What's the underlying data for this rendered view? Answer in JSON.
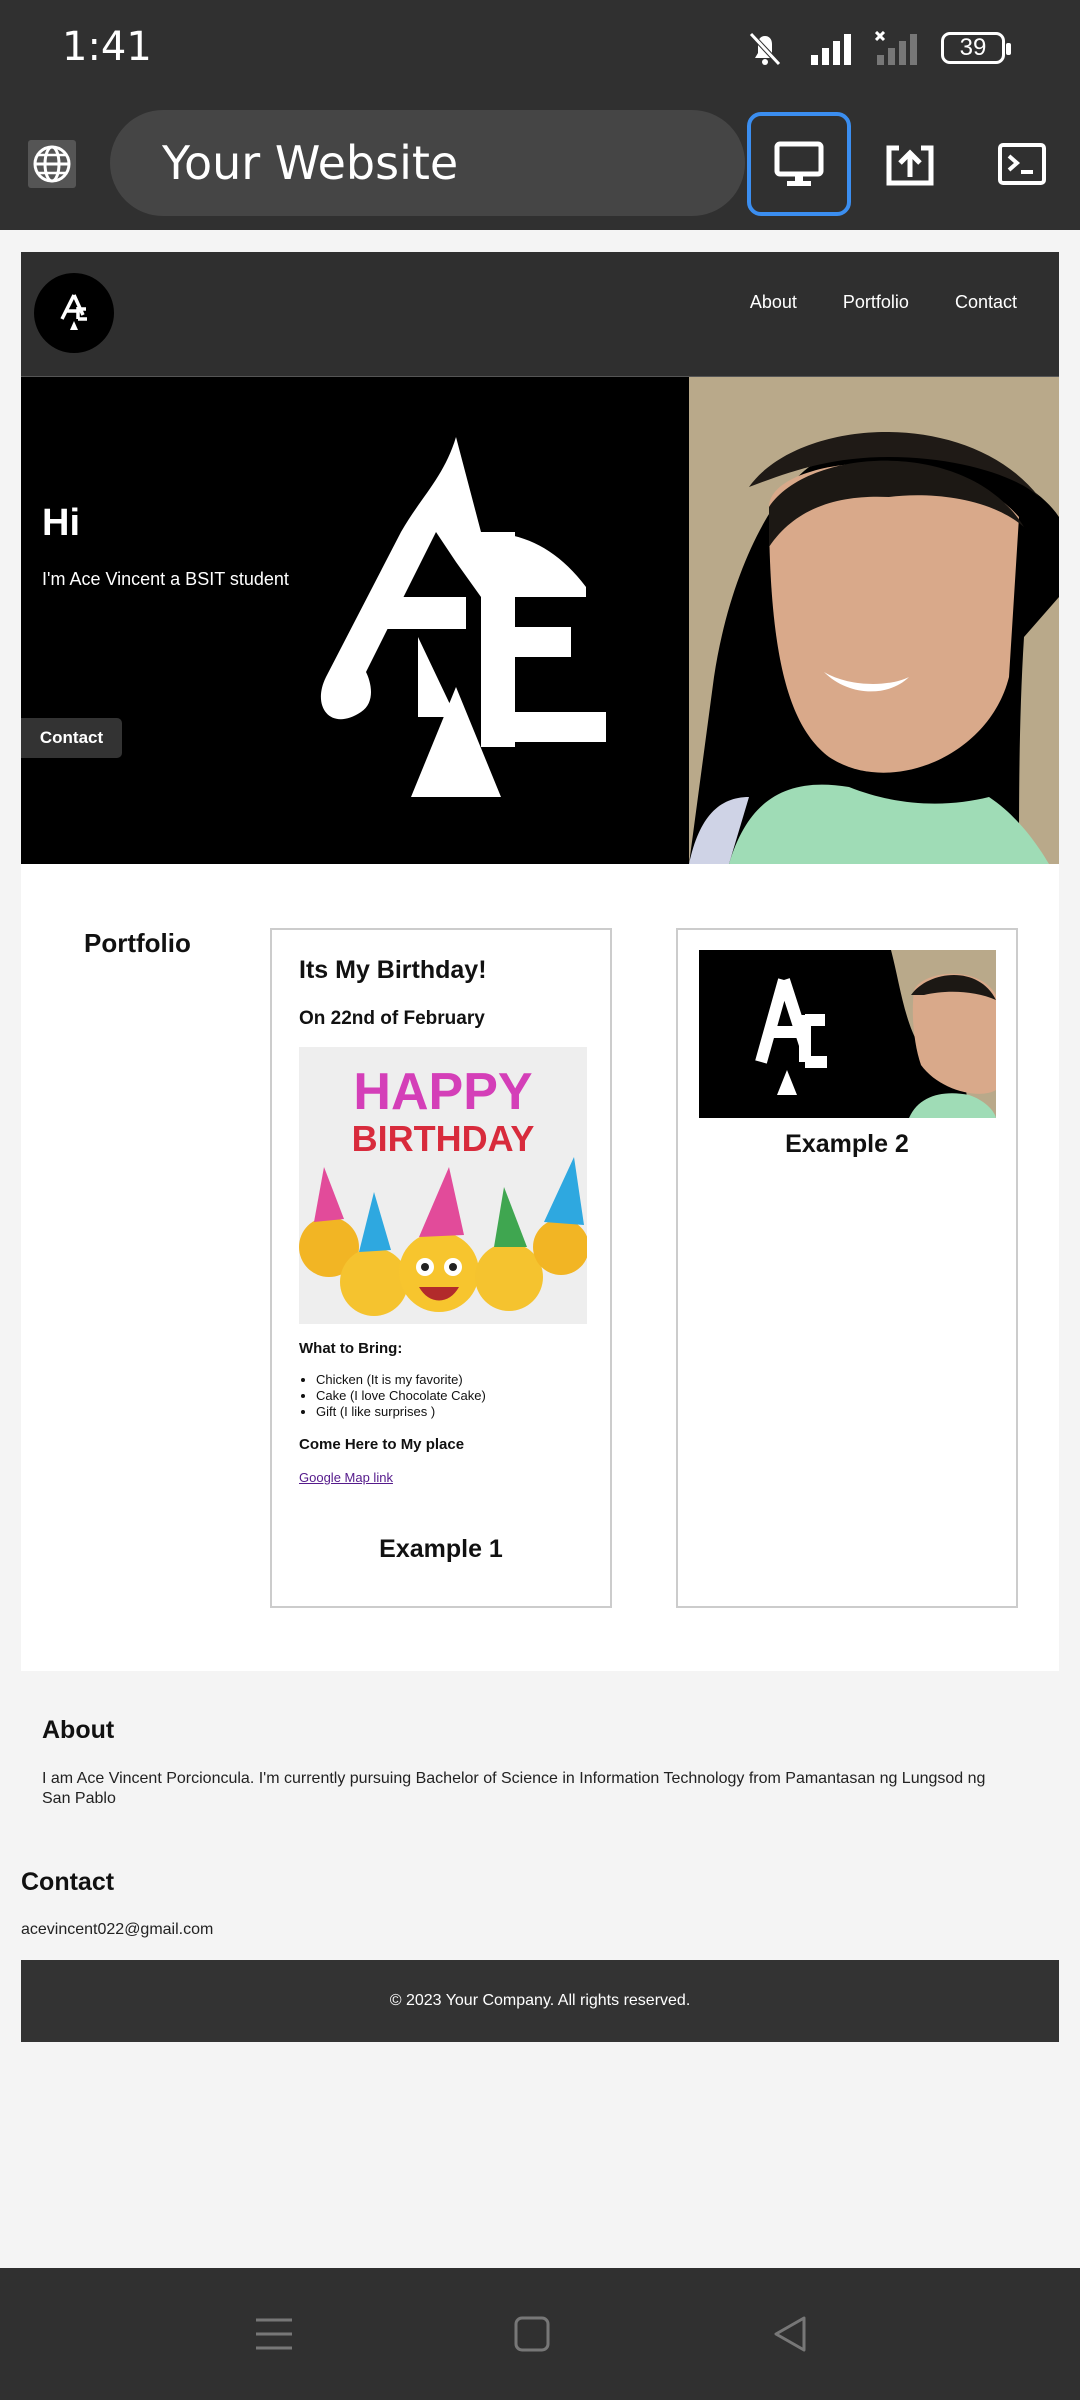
{
  "status": {
    "time": "1:41",
    "battery": "39"
  },
  "browser": {
    "url": "Your Website"
  },
  "nav": {
    "links": [
      "About",
      "Portfolio",
      "Contact"
    ]
  },
  "hero": {
    "title": "Hi",
    "subtitle": "I'm Ace Vincent a BSIT student",
    "button": "Contact"
  },
  "portfolio": {
    "title": "Portfolio",
    "card1": {
      "title": "Its My Birthday!",
      "date": "On 22nd of February",
      "banner_line1": "HAPPY",
      "banner_line2": "BIRTHDAY",
      "bring_title": "What to Bring:",
      "items": [
        "Chicken (It is my favorite)",
        "Cake (I love Chocolate Cake)",
        "Gift (I like surprises )"
      ],
      "come_title": "Come Here to My place",
      "link": "Google Map link",
      "label": "Example 1"
    },
    "card2": {
      "label": "Example 2"
    }
  },
  "about": {
    "title": "About",
    "text": "I am Ace Vincent Porcioncula. I'm currently pursuing Bachelor of Science in Information Technology from Pamantasan ng Lungsod ng San Pablo"
  },
  "contact": {
    "title": "Contact",
    "email": "acevincent022@gmail.com"
  },
  "footer": {
    "text": "© 2023 Your Company. All rights reserved."
  },
  "colors": {
    "header_bg": "#303030",
    "site_nav_bg": "#2f2f2f",
    "accent_selected": "#3b8ef0",
    "link": "#551a8b"
  }
}
